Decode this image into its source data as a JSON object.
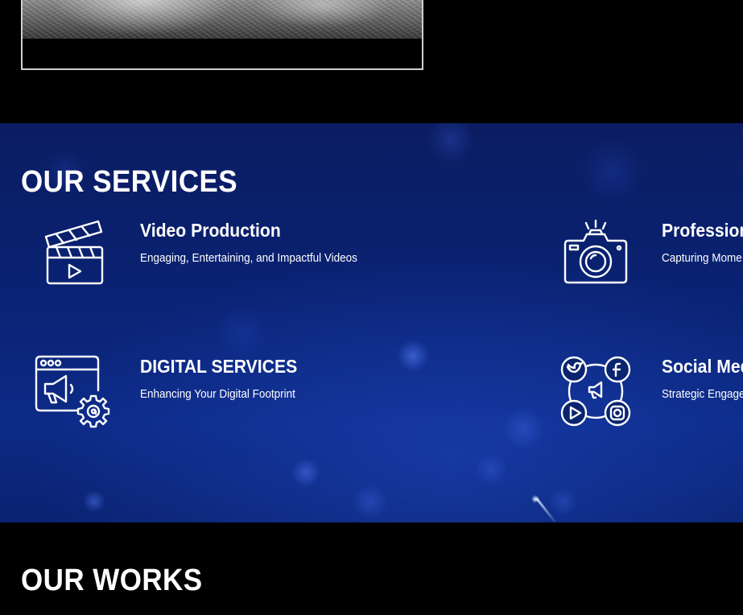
{
  "hero": {
    "image_description_icon": "city-aerial-photo"
  },
  "services": {
    "heading": "OUR SERVICES",
    "items": [
      {
        "title": "Video Production",
        "description": "Engaging, Entertaining, and Impactful Videos",
        "icon": "clapperboard-icon"
      },
      {
        "title": "Profession",
        "description": "Capturing Mome",
        "icon": "camera-icon"
      },
      {
        "title": "DIGITAL SERVICES",
        "description": "Enhancing Your Digital Footprint",
        "icon": "digital-marketing-icon"
      },
      {
        "title": "Social Med",
        "description": "Strategic Engage",
        "icon": "social-media-icon"
      }
    ]
  },
  "works": {
    "heading": "OUR WORKS"
  },
  "colors": {
    "page_background": "#000000",
    "services_background": "#0a2272",
    "text": "#ffffff"
  }
}
